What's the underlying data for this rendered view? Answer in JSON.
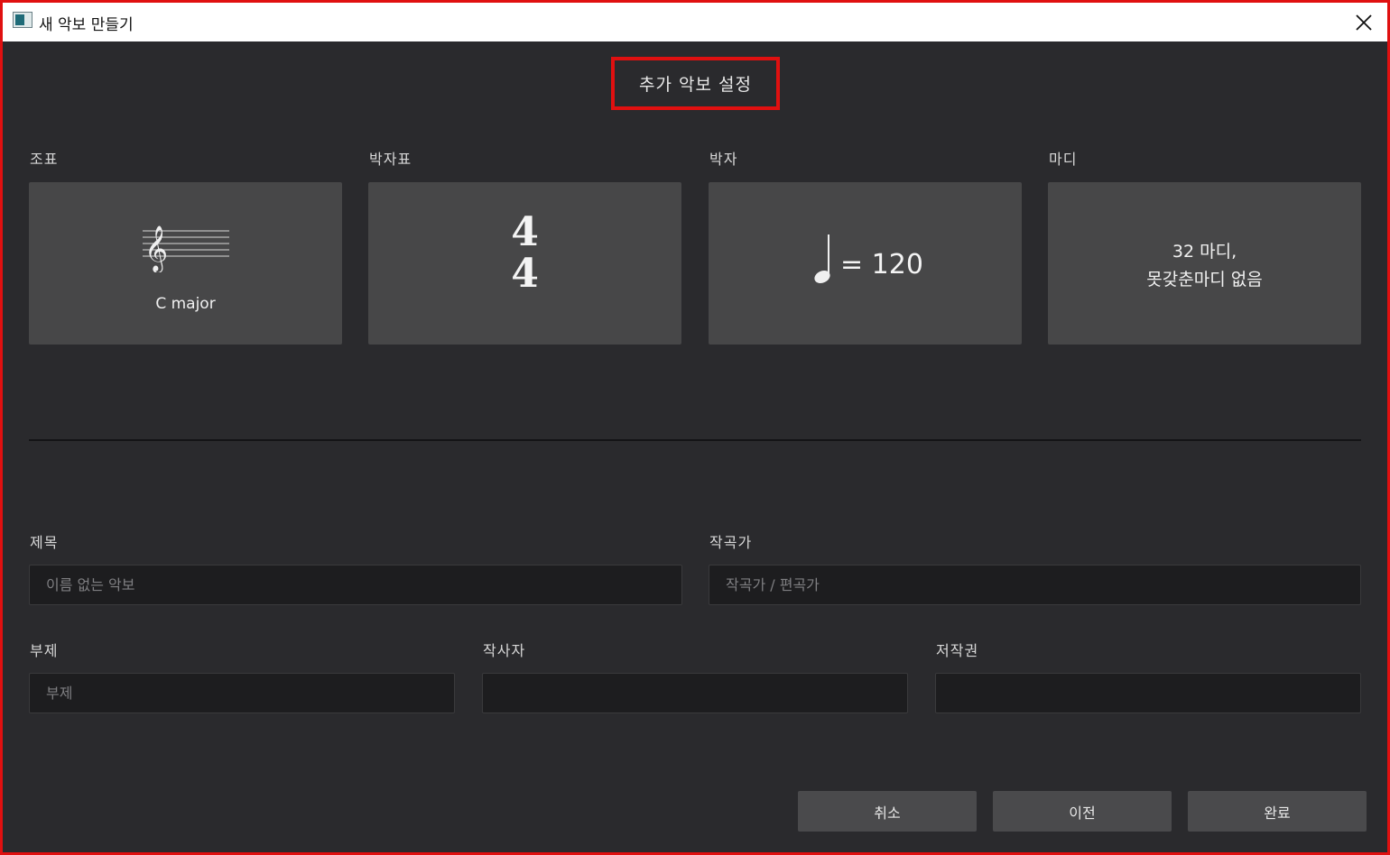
{
  "window": {
    "title": "새 악보 만들기"
  },
  "heading": "추가 악보 설정",
  "cards": {
    "key": {
      "label": "조표",
      "value": "C major"
    },
    "time": {
      "label": "박자표",
      "numerator": "4",
      "denominator": "4"
    },
    "tempo": {
      "label": "박자",
      "value": "= 120"
    },
    "measures": {
      "label": "마디",
      "line1": "32 마디,",
      "line2": "못갖춘마디 없음"
    }
  },
  "fields": {
    "title": {
      "label": "제목",
      "placeholder": "이름 없는 악보",
      "value": ""
    },
    "composer": {
      "label": "작곡가",
      "placeholder": "작곡가 / 편곡가",
      "value": ""
    },
    "subtitle": {
      "label": "부제",
      "placeholder": "부제",
      "value": ""
    },
    "lyricist": {
      "label": "작사자",
      "placeholder": "",
      "value": ""
    },
    "copyright": {
      "label": "저작권",
      "placeholder": "",
      "value": ""
    }
  },
  "buttons": {
    "cancel": "취소",
    "back": "이전",
    "finish": "완료"
  },
  "icons": {
    "app": "app-icon",
    "close": "close-icon",
    "treble_clef": "treble-clef-icon",
    "quarter_note": "quarter-note-icon"
  },
  "colors": {
    "highlight": "#e01010",
    "background": "#2a2a2d",
    "card": "#474748",
    "input": "#1d1d1f"
  }
}
